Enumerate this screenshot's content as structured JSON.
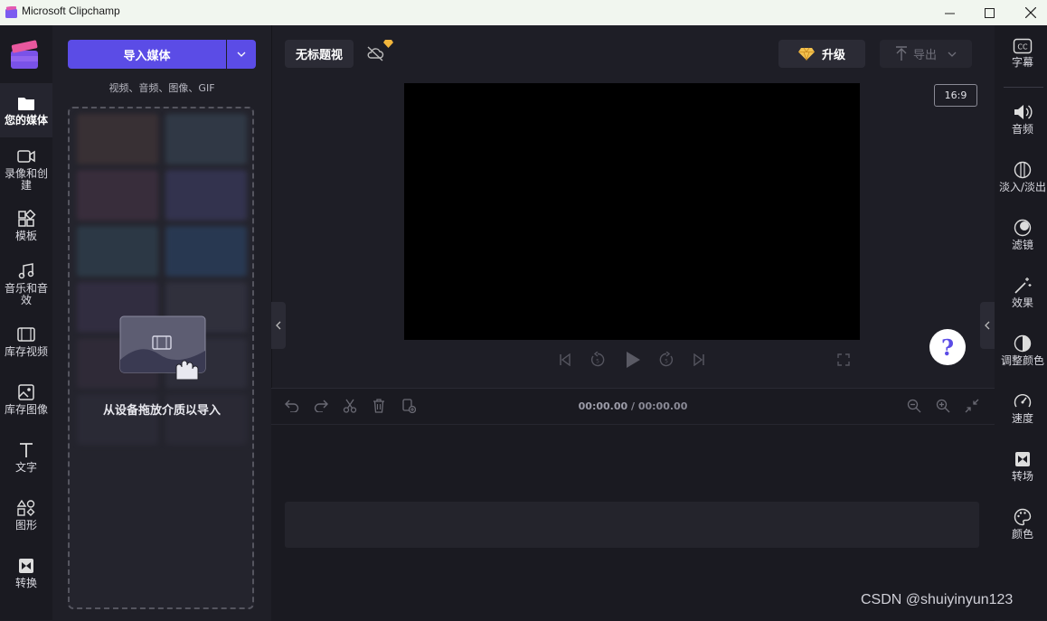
{
  "window": {
    "title": "Microsoft Clipchamp"
  },
  "left_rail": {
    "items": [
      {
        "label": "您的媒体",
        "icon": "folder-icon"
      },
      {
        "label": "录像和创建",
        "icon": "video-camera-icon"
      },
      {
        "label": "模板",
        "icon": "templates-icon"
      },
      {
        "label": "音乐和音效",
        "icon": "music-note-icon"
      },
      {
        "label": "库存视频",
        "icon": "film-icon"
      },
      {
        "label": "库存图像",
        "icon": "image-icon"
      },
      {
        "label": "文字",
        "icon": "text-icon"
      },
      {
        "label": "图形",
        "icon": "shapes-icon"
      },
      {
        "label": "转换",
        "icon": "transition-icon"
      }
    ]
  },
  "media_panel": {
    "import_label": "导入媒体",
    "formats": "视频、音频、图像、GIF",
    "drop_message": "从设备拖放介质以导入"
  },
  "topbar": {
    "project_title": "无标题视",
    "upgrade_label": "升级",
    "export_label": "导出"
  },
  "preview": {
    "aspect_ratio": "16:9",
    "help": "?"
  },
  "timeline": {
    "current_time": "00:00.00",
    "separator": " / ",
    "total_time": "00:00.00"
  },
  "right_rail": {
    "items": [
      {
        "label": "字幕",
        "icon": "captions-icon"
      },
      {
        "label": "音频",
        "icon": "speaker-icon"
      },
      {
        "label": "淡入/淡出",
        "icon": "fade-icon"
      },
      {
        "label": "滤镜",
        "icon": "filter-icon"
      },
      {
        "label": "效果",
        "icon": "magic-wand-icon"
      },
      {
        "label": "调整颜色",
        "icon": "contrast-icon"
      },
      {
        "label": "速度",
        "icon": "speedometer-icon"
      },
      {
        "label": "转场",
        "icon": "transition-icon"
      },
      {
        "label": "颜色",
        "icon": "palette-icon"
      }
    ]
  },
  "watermark": "CSDN @shuiyinyun123",
  "colors": {
    "accent": "#5b4ce6",
    "background": "#1e1e26",
    "rail": "#1a1a21"
  }
}
